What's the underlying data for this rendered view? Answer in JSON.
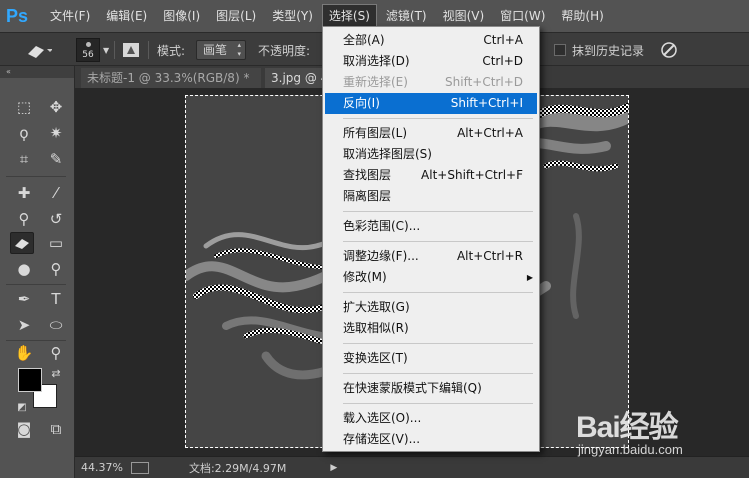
{
  "app": {
    "logo": "Ps",
    "menu": [
      "文件(F)",
      "编辑(E)",
      "图像(I)",
      "图层(L)",
      "类型(Y)",
      "选择(S)",
      "滤镜(T)",
      "视图(V)",
      "窗口(W)",
      "帮助(H)"
    ],
    "active_menu": "选择(S)"
  },
  "options": {
    "brush_size": "56",
    "mode_label": "模式:",
    "mode_value": "画笔",
    "opacity_label": "不透明度:",
    "history_label": "抹到历史记录"
  },
  "tabs": [
    {
      "label": "未标题-1 @ 33.3%(RGB/8) *",
      "close": "×"
    },
    {
      "label": "3.jpg @ 4"
    }
  ],
  "status": {
    "zoom": "44.37%",
    "doc": "文档:2.29M/4.97M"
  },
  "dropdown": {
    "groups": [
      [
        {
          "label": "全部(A)",
          "shortcut": "Ctrl+A"
        },
        {
          "label": "取消选择(D)",
          "shortcut": "Ctrl+D"
        },
        {
          "label": "重新选择(E)",
          "shortcut": "Shift+Ctrl+D",
          "disabled": true
        },
        {
          "label": "反向(I)",
          "shortcut": "Shift+Ctrl+I",
          "highlighted": true
        }
      ],
      [
        {
          "label": "所有图层(L)",
          "shortcut": "Alt+Ctrl+A"
        },
        {
          "label": "取消选择图层(S)",
          "shortcut": ""
        },
        {
          "label": "查找图层",
          "shortcut": "Alt+Shift+Ctrl+F"
        },
        {
          "label": "隔离图层",
          "shortcut": ""
        }
      ],
      [
        {
          "label": "色彩范围(C)...",
          "shortcut": ""
        }
      ],
      [
        {
          "label": "调整边缘(F)...",
          "shortcut": "Alt+Ctrl+R"
        },
        {
          "label": "修改(M)",
          "shortcut": "",
          "submenu": true
        }
      ],
      [
        {
          "label": "扩大选取(G)",
          "shortcut": ""
        },
        {
          "label": "选取相似(R)",
          "shortcut": ""
        }
      ],
      [
        {
          "label": "变换选区(T)",
          "shortcut": ""
        }
      ],
      [
        {
          "label": "在快速蒙版模式下编辑(Q)",
          "shortcut": ""
        }
      ],
      [
        {
          "label": "载入选区(O)...",
          "shortcut": ""
        },
        {
          "label": "存储选区(V)...",
          "shortcut": ""
        }
      ]
    ]
  },
  "watermark": {
    "logo": "Bai经验",
    "url": "jingyan.baidu.com"
  },
  "colors": {
    "highlight": "#0a6fd1",
    "menubar": "#535353",
    "ps_blue": "#31a8ff"
  }
}
